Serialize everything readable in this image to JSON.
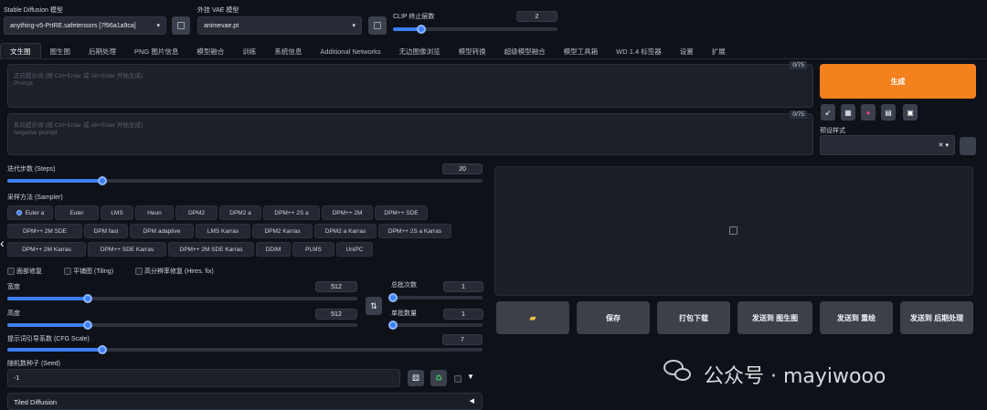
{
  "top": {
    "sd_model_label": "Stable Diffusion 模型",
    "sd_model_value": "anything-v5-PrtRE.safetensors [7f96a1a9ca]",
    "vae_label": "外挂 VAE 模型",
    "vae_value": "animevae.pt",
    "clip_label": "CLIP 终止层数",
    "clip_value": "2",
    "clip_fraction": 0.17
  },
  "tabs": [
    "文生图",
    "图生图",
    "后期处理",
    "PNG 图片信息",
    "模型融合",
    "训练",
    "系统信息",
    "Additional Networks",
    "无边图像浏览",
    "模型转换",
    "超级模型融合",
    "模型工具箱",
    "WD 1.4 标签器",
    "设置",
    "扩展"
  ],
  "prompt": {
    "placeholder_1": "正向提示词 (按 Ctrl+Enter 或 Alt+Enter 开始生成)",
    "placeholder_2": "Prompt",
    "counter": "0/75"
  },
  "negative": {
    "placeholder_1": "反向提示词 (按 Ctrl+Enter 或 Alt+Enter 开始生成)",
    "placeholder_2": "Negative prompt",
    "counter": "0/75"
  },
  "generate_label": "生成",
  "preset_label": "预设样式",
  "steps": {
    "label": "迭代步数 (Steps)",
    "value": "20",
    "fraction": 0.2
  },
  "sampler": {
    "label": "采样方法 (Sampler)",
    "row1": [
      "Euler a",
      "Euler",
      "LMS",
      "Heun",
      "DPM2",
      "DPM2 a",
      "DPM++ 2S a",
      "DPM++ 2M",
      "DPM++ SDE"
    ],
    "row2": [
      "DPM++ 2M SDE",
      "DPM fast",
      "DPM adaptive",
      "LMS Karras",
      "DPM2 Karras",
      "DPM2 a Karras",
      "DPM++ 2S a Karras"
    ],
    "row3": [
      "DPM++ 2M Karras",
      "DPM++ SDE Karras",
      "DPM++ 2M SDE Karras",
      "DDIM",
      "PLMS",
      "UniPC"
    ]
  },
  "checks": {
    "restore_faces": "面部修复",
    "tiling": "平铺图 (Tiling)",
    "hires": "高分辨率修复 (Hires. fix)"
  },
  "width": {
    "label": "宽度",
    "value": "512",
    "fraction": 0.23
  },
  "height": {
    "label": "高度",
    "value": "512",
    "fraction": 0.23
  },
  "batch_count": {
    "label": "总批次数",
    "value": "1",
    "fraction": 0.02
  },
  "batch_size": {
    "label": "单批数量",
    "value": "1",
    "fraction": 0.02
  },
  "cfg": {
    "label": "提示词引导系数 (CFG Scale)",
    "value": "7",
    "fraction": 0.2
  },
  "seed": {
    "label": "随机数种子 (Seed)",
    "value": "-1"
  },
  "tiled_diffusion": "Tiled Diffusion",
  "actions": [
    "保存",
    "打包下载",
    "发送到 图生图",
    "发送到 重绘",
    "发送到 后期处理"
  ],
  "watermark": "公众号 · mayiwooo",
  "colors": {
    "accent": "#3d7ff5",
    "generate": "#f4801e",
    "bg": "#0e1117"
  }
}
